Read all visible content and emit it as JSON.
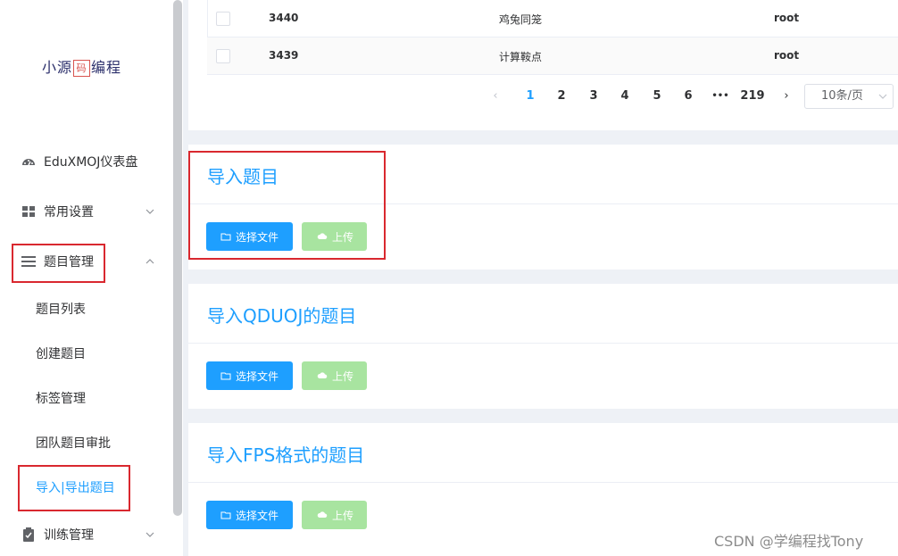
{
  "sidebar": {
    "logo_left": "小源",
    "logo_mark": "码",
    "logo_right": "编程",
    "items": [
      {
        "label": "EduXMOJ仪表盘",
        "icon": "dashboard-icon"
      },
      {
        "label": "常用设置",
        "icon": "grid-icon"
      },
      {
        "label": "题目管理",
        "icon": "menu-icon"
      }
    ],
    "sub_items": [
      {
        "label": "题目列表"
      },
      {
        "label": "创建题目"
      },
      {
        "label": "标签管理"
      },
      {
        "label": "团队题目审批"
      },
      {
        "label": "导入|导出题目"
      }
    ],
    "bottom_item": {
      "label": "训练管理",
      "icon": "clipboard-icon"
    }
  },
  "table": {
    "rows": [
      {
        "id": "3440",
        "title": "鸡兔同笼",
        "author": "root"
      },
      {
        "id": "3439",
        "title": "计算鞍点",
        "author": "root"
      }
    ]
  },
  "pagination": {
    "pages": [
      "1",
      "2",
      "3",
      "4",
      "5",
      "6"
    ],
    "ellipsis": "•••",
    "last": "219",
    "current": "1",
    "page_size": "10条/页"
  },
  "import_sections": [
    {
      "title": "导入题目",
      "select_label": "选择文件",
      "upload_label": "上传"
    },
    {
      "title": "导入QDUOJ的题目",
      "select_label": "选择文件",
      "upload_label": "上传"
    },
    {
      "title": "导入FPS格式的题目",
      "select_label": "选择文件",
      "upload_label": "上传"
    }
  ],
  "watermark": "CSDN @学编程找Tony",
  "colors": {
    "accent": "#1e9fff",
    "upload_disabled": "#a8e4a0",
    "highlight_box": "#d9282f"
  }
}
